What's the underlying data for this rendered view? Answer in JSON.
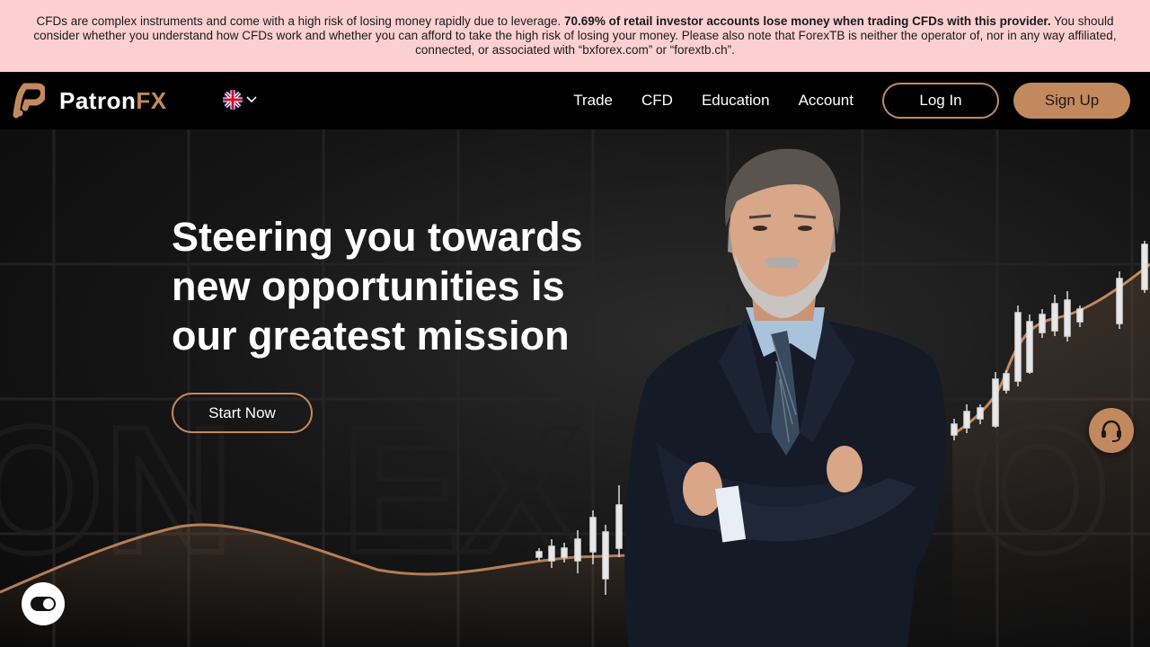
{
  "risk_banner": {
    "text_before": "CFDs are complex instruments and come with a high risk of losing money rapidly due to leverage. ",
    "text_bold": "70.69% of retail investor accounts lose money when trading CFDs with this provider.",
    "text_after": " You should consider whether you understand how CFDs work and whether you can afford to take the high risk of losing your money. Please also note that ForexTB is neither the operator of, nor in any way affiliated, connected, or associated with “bxforex.com” or “forextb.ch”."
  },
  "brand": {
    "name_main": "Patron",
    "name_accent": "FX",
    "accent_color": "#c3895e"
  },
  "language": {
    "selected": "English (UK)",
    "icon": "uk-flag-icon"
  },
  "nav": {
    "links": [
      "Trade",
      "CFD",
      "Education",
      "Account"
    ],
    "login_label": "Log In",
    "signup_label": "Sign Up"
  },
  "hero": {
    "headline": "Steering you towards new opportunities is our greatest mission",
    "cta_label": "Start Now"
  },
  "floating": {
    "support_icon": "headset-icon",
    "toggle_icon": "toggle-icon"
  }
}
